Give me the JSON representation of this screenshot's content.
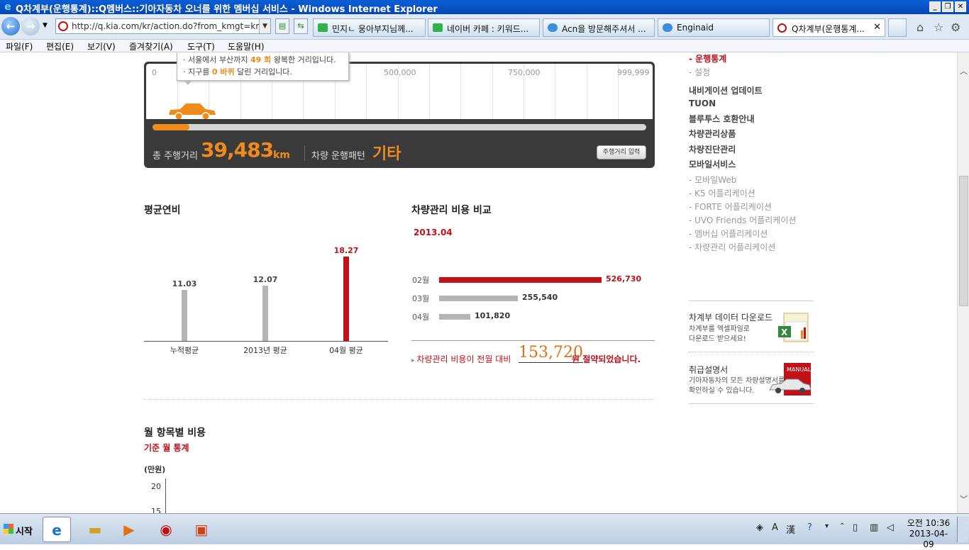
{
  "window": {
    "title": "Q차계부(운행통계)::Q멤버스::기아자동차 오너를 위한 멤버십 서비스 - Windows Internet Explorer"
  },
  "browser": {
    "url": "http://q.kia.com/kr/action.do?from_kmgt=kr",
    "tabs": [
      {
        "label": "민지ㄴ 웅아부지님께...",
        "active": false
      },
      {
        "label": "네이버 카페 : 키워드...",
        "active": false
      },
      {
        "label": "Acn을 방문해주셔서 ...",
        "active": false
      },
      {
        "label": "Enginaid",
        "active": false
      },
      {
        "label": "Q차계부(운행통계...",
        "active": true
      }
    ],
    "menu": [
      "파일(F)",
      "편집(E)",
      "보기(V)",
      "즐겨찾기(A)",
      "도구(T)",
      "도움말(H)"
    ]
  },
  "odometer": {
    "ticks": [
      "0",
      "500,000",
      "750,000",
      "999,999"
    ],
    "total_label": "총 주행거리",
    "total_value": "39,483",
    "total_unit": "km",
    "pattern_label": "차량 운행패턴",
    "pattern_value": "기타",
    "input_button": "주행거리 입력",
    "progress_fraction": 0.039,
    "tooltip": {
      "line1_pre": "· 서울에서 부산까지 ",
      "line1_hl": "49 회",
      "line1_post": " 왕복한 거리입니다.",
      "line2_pre": "· 지구를 ",
      "line2_hl": "0 바퀴",
      "line2_post": " 달린 거리입니다."
    }
  },
  "fuel": {
    "title": "평균연비",
    "bars": [
      {
        "label": "누적평균",
        "value": "11.03",
        "hot": false
      },
      {
        "label": "2013년 평균",
        "value": "12.07",
        "hot": false
      },
      {
        "label": "04월 평균",
        "value": "18.27",
        "hot": true
      }
    ]
  },
  "cost": {
    "title": "차량관리 비용 비교",
    "period": "2013.04",
    "bars": [
      {
        "label": "02월",
        "value": "526,730",
        "hot": true
      },
      {
        "label": "03월",
        "value": "255,540",
        "hot": false
      },
      {
        "label": "04월",
        "value": "101,820",
        "hot": false
      }
    ],
    "savings_pre": "차량관리 비용이 전월 대비",
    "savings_amount": "153,720",
    "savings_post": "원 절약되었습니다."
  },
  "monthly": {
    "title": "월 항목별 비용",
    "subtitle": "기준 월 통계",
    "unit": "(만원)",
    "ticks": [
      "20",
      "15"
    ]
  },
  "chart_data": [
    {
      "type": "bar",
      "title": "평균연비",
      "categories": [
        "누적평균",
        "2013년 평균",
        "04월 평균"
      ],
      "values": [
        11.03,
        12.07,
        18.27
      ]
    },
    {
      "type": "bar",
      "title": "차량관리 비용 비교",
      "subtitle": "2013.04",
      "orientation": "horizontal",
      "categories": [
        "02월",
        "03월",
        "04월"
      ],
      "values": [
        526730,
        255540,
        101820
      ]
    }
  ],
  "sidebar": {
    "current": "- 운행통계",
    "settings": "- 설정",
    "mains": [
      "내비게이션 업데이트",
      "TUON",
      "블루투스 호환안내",
      "차량관리상품",
      "차량진단관리",
      "모바일서비스"
    ],
    "mobile_items": [
      "- 모바일Web",
      "- K5 어플리케이션",
      "- FORTE 어플리케이션",
      "- UVO Friends 어플리케이션",
      "- 멤버십 어플리케이션",
      "- 차량관리 어플리케이션"
    ],
    "download": {
      "title": "차계부 데이터 다운로드",
      "desc1": "차계부를 엑셀파일로",
      "desc2": "다운로드 받으세요!"
    },
    "manual": {
      "title": "취급설명서",
      "desc1": "기아자동차의 모든 차량설명서를",
      "desc2": "확인하실 수 있습니다."
    }
  },
  "taskbar": {
    "start": "시작",
    "clock_line1": "오전 10:36",
    "clock_line2": "2013-04-09"
  }
}
